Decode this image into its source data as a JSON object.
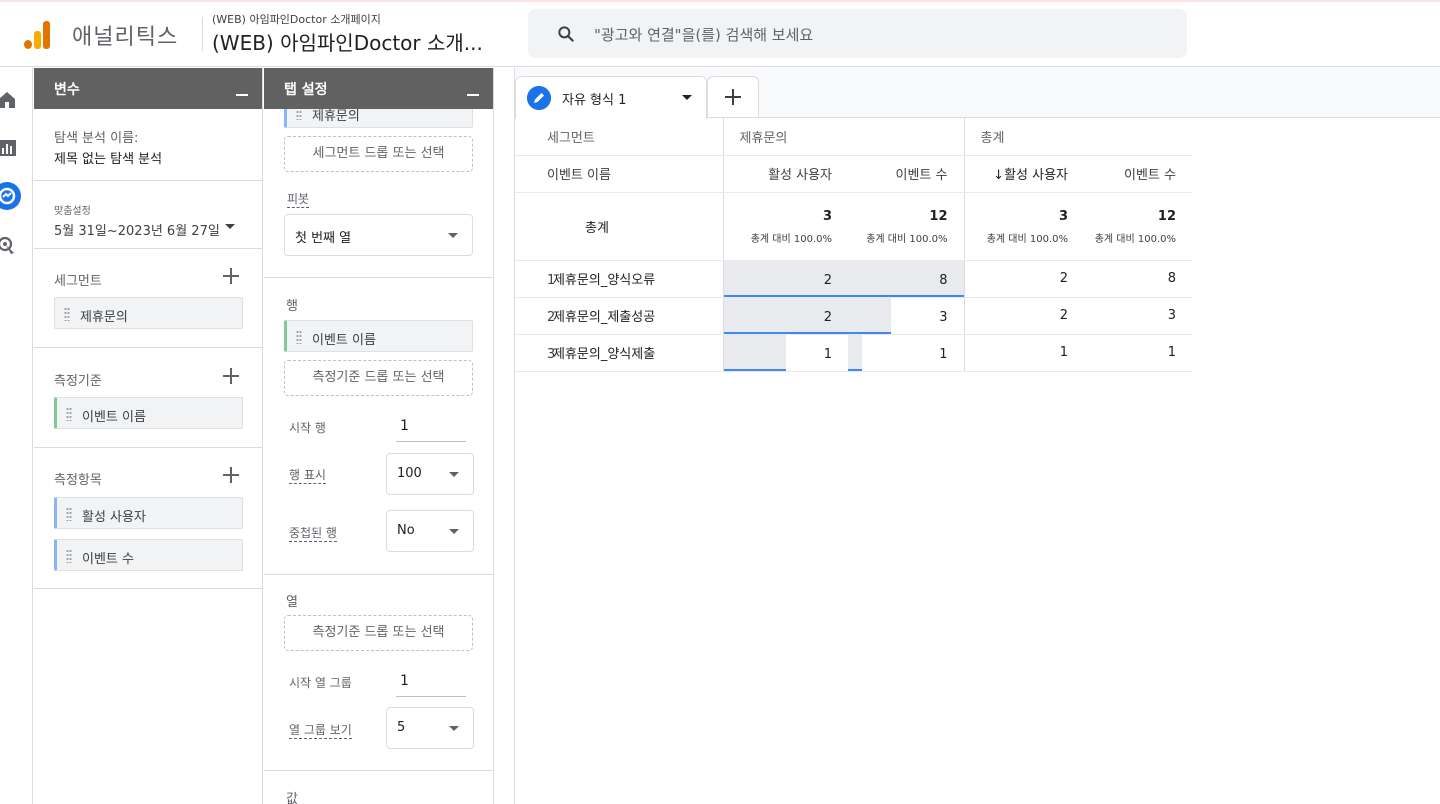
{
  "header": {
    "app_name": "애널리틱스",
    "property_small": "(WEB) 아임파인Doctor 소개페이지",
    "property_big": "(WEB) 아임파인Doctor 소개...",
    "search_placeholder": "\"광고와 연결\"을(를) 검색해 보세요"
  },
  "variables": {
    "title": "변수",
    "exploration_label": "탐색 분석 이름:",
    "exploration_name": "제목 없는 탐색 분석",
    "date_label": "맞춤설정",
    "date_range": "5월 31일~2023년 6월 27일",
    "segments_label": "세그먼트",
    "segments": [
      "제휴문의"
    ],
    "dimensions_label": "측정기준",
    "dimensions": [
      "이벤트 이름"
    ],
    "metrics_label": "측정항목",
    "metrics": [
      "활성 사용자",
      "이벤트 수"
    ]
  },
  "tab_settings": {
    "title": "탭 설정",
    "top_chip": "제휴문의",
    "segment_drop": "세그먼트 드롭 또는 선택",
    "pivot_label": "피봇",
    "pivot_value": "첫 번째 열",
    "rows_label": "행",
    "rows_chip": "이벤트 이름",
    "rows_drop": "측정기준 드롭 또는 선택",
    "start_row_label": "시작 행",
    "start_row_value": "1",
    "show_rows_label": "행 표시",
    "show_rows_value": "100",
    "nested_rows_label": "중첩된 행",
    "nested_rows_value": "No",
    "columns_label": "열",
    "columns_drop": "측정기준 드롭 또는 선택",
    "start_col_label": "시작 열 그룹",
    "start_col_value": "1",
    "show_col_label": "열 그룹 보기",
    "show_col_value": "5",
    "values_label": "값"
  },
  "report": {
    "tab_name": "자유 형식 1",
    "header_segment": "세그먼트",
    "header_group1": "제휴문의",
    "header_group2": "총계",
    "header_dimension": "이벤트 이름",
    "col_active_users": "활성 사용자",
    "col_event_count": "이벤트 수",
    "col_active_users_sorted": "↓활성 사용자",
    "col_event_count_2": "이벤트 수",
    "totals_label": "총계",
    "totals": [
      {
        "value": "3",
        "sub": "총계 대비 100.0%"
      },
      {
        "value": "12",
        "sub": "총계 대비 100.0%"
      },
      {
        "value": "3",
        "sub": "총계 대비 100.0%"
      },
      {
        "value": "12",
        "sub": "총계 대비 100.0%"
      }
    ],
    "rows": [
      {
        "num": "1",
        "name": "제휴문의_양식오류",
        "a": "2",
        "b": "8",
        "c": "2",
        "d": "8",
        "a_frac": 1.0,
        "b_frac": 1.0
      },
      {
        "num": "2",
        "name": "제휴문의_제출성공",
        "a": "2",
        "b": "3",
        "c": "2",
        "d": "3",
        "a_frac": 1.0,
        "b_frac": 0.375
      },
      {
        "num": "3",
        "name": "제휴문의_양식제출",
        "a": "1",
        "b": "1",
        "c": "1",
        "d": "1",
        "a_frac": 0.5,
        "b_frac": 0.125
      }
    ]
  }
}
